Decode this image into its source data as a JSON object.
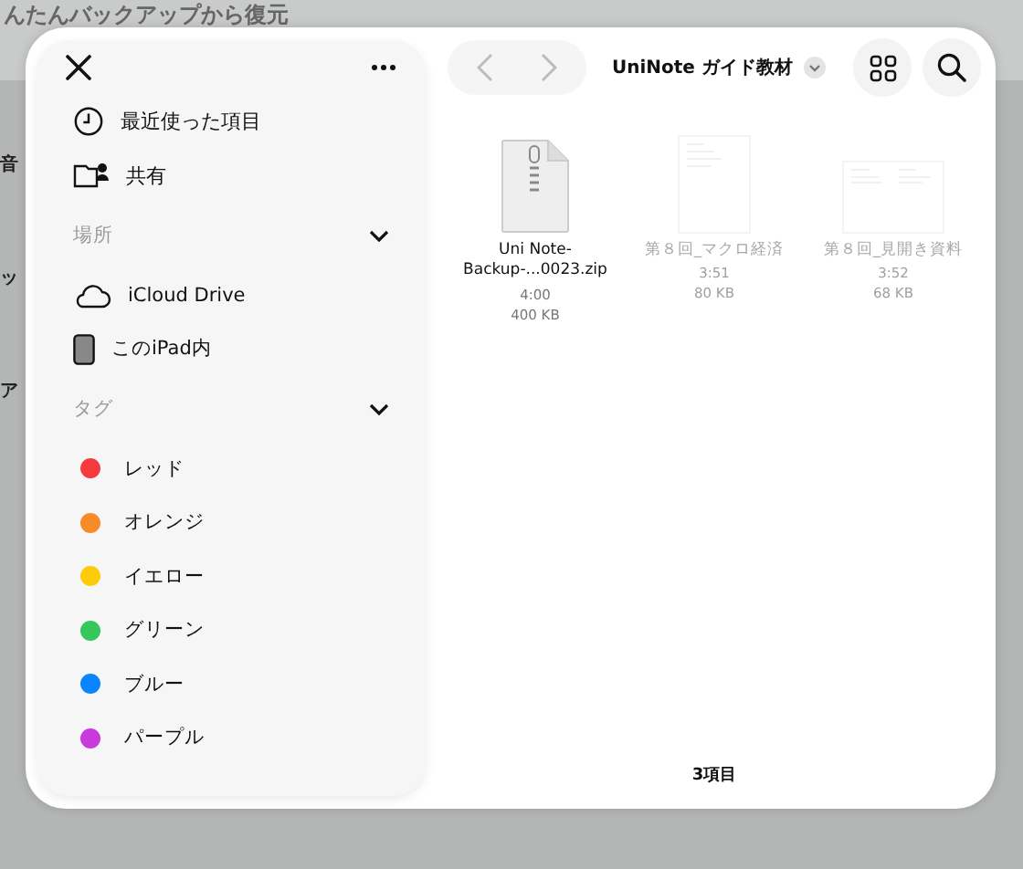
{
  "background": {
    "title": "んたんバックアップから復元",
    "rows": [
      "音",
      "ッ",
      "ア"
    ]
  },
  "sidebar": {
    "favorites": [
      {
        "kind": "recent",
        "label": "最近使った項目"
      },
      {
        "kind": "shared",
        "label": "共有"
      }
    ],
    "sections": [
      {
        "title": "場所",
        "expanded": true,
        "items": [
          {
            "kind": "cloud",
            "label": "iCloud Drive"
          },
          {
            "kind": "ipad",
            "label": "このiPad内"
          }
        ]
      },
      {
        "title": "タグ",
        "expanded": true,
        "items": [
          {
            "kind": "tag",
            "label": "レッド",
            "color": "#f5393c"
          },
          {
            "kind": "tag",
            "label": "オレンジ",
            "color": "#f78a2b"
          },
          {
            "kind": "tag",
            "label": "イエロー",
            "color": "#fdcb0a"
          },
          {
            "kind": "tag",
            "label": "グリーン",
            "color": "#35c759"
          },
          {
            "kind": "tag",
            "label": "ブルー",
            "color": "#0a84ff"
          },
          {
            "kind": "tag",
            "label": "パープル",
            "color": "#c83ada"
          }
        ]
      }
    ]
  },
  "toolbar": {
    "folder": "UniNote ガイド教材"
  },
  "files": [
    {
      "kind": "zip",
      "name": "Uni Note-\nBackup-...0023.zip",
      "time": "4:00",
      "size": "400 KB",
      "disabled": false
    },
    {
      "kind": "doc",
      "name": "第８回_マクロ経済",
      "time": "3:51",
      "size": "80 KB",
      "disabled": true
    },
    {
      "kind": "sheet",
      "name": "第８回_見開き資料",
      "time": "3:52",
      "size": "68 KB",
      "disabled": true
    }
  ],
  "status": "3項目"
}
